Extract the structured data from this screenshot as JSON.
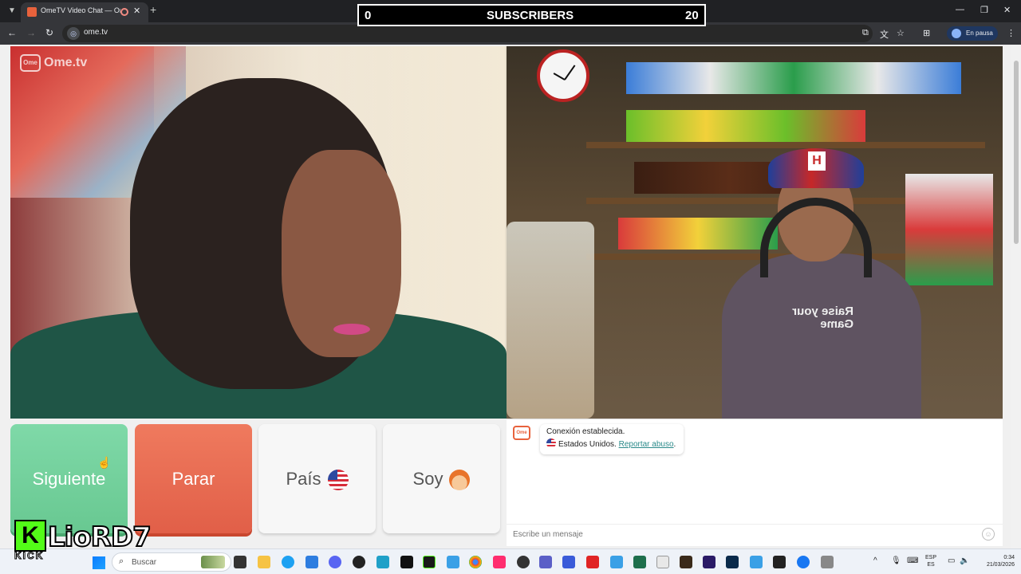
{
  "browser": {
    "tab_title": "OmeTV Video Chat — Ome",
    "url": "ome.tv",
    "profile_label": "En pausa"
  },
  "overlay": {
    "left_count": "0",
    "label": "SUBSCRIBERS",
    "right_count": "20"
  },
  "video": {
    "watermark": "Ome.tv",
    "shirt_text": "Raise your Game"
  },
  "buttons": {
    "next": "Siguiente",
    "stop": "Parar",
    "country": "País",
    "gender": "Soy"
  },
  "chat": {
    "connected": "Conexión establecida.",
    "location": "Estados Unidos.",
    "report_link": "Reportar abuso",
    "input_placeholder": "Escribe un mensaje"
  },
  "streamer": {
    "platform_text": "KICK",
    "channel": "LioRD7"
  },
  "taskbar": {
    "search_placeholder": "Buscar",
    "lang_line1": "ESP",
    "lang_line2": "ES",
    "time": "0:34",
    "date": "21/03/2026"
  },
  "colors": {
    "next_green": "#68c891",
    "stop_red": "#e15f48",
    "kick_green": "#53fc18",
    "link_teal": "#2b8a8a"
  }
}
